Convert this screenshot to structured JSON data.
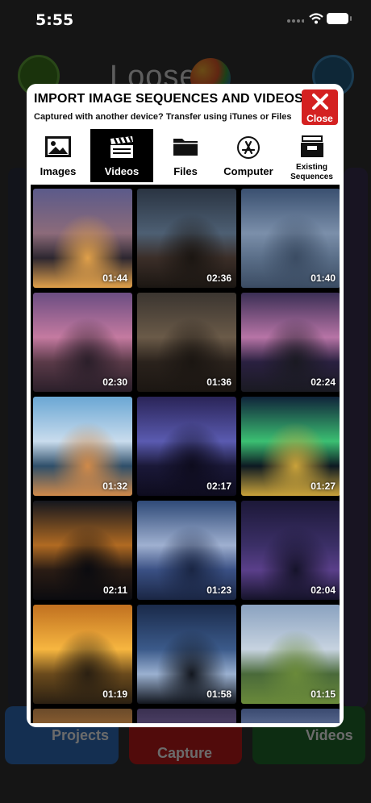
{
  "status": {
    "time": "5:55"
  },
  "background": {
    "logo_text": "Loose   it",
    "projects_label": "Projects",
    "capture_label": "Capture",
    "videos_label": "Videos"
  },
  "modal": {
    "title": "IMPORT IMAGE SEQUENCES AND VIDEOS",
    "subtitle": "Captured with another device? Transfer using iTunes or Files",
    "close_label": "Close",
    "tabs": [
      {
        "label": "Images",
        "icon": "image-icon"
      },
      {
        "label": "Videos",
        "icon": "clapperboard-icon",
        "active": true
      },
      {
        "label": "Files",
        "icon": "folder-icon"
      },
      {
        "label": "Computer",
        "icon": "app-store-icon"
      },
      {
        "label": "Existing Sequences",
        "icon": "archive-drawer-icon"
      }
    ],
    "videos": [
      {
        "duration": "01:44",
        "scene": "city night skyline",
        "colors": [
          "#5b5a8a",
          "#8c6b7a",
          "#2d2730",
          "#e0a04a"
        ]
      },
      {
        "duration": "02:36",
        "scene": "cave with lightning",
        "colors": [
          "#2a3442",
          "#4d5f73",
          "#3b2e28",
          "#1b1612"
        ]
      },
      {
        "duration": "01:40",
        "scene": "harbor skyline dusk",
        "colors": [
          "#3a5070",
          "#7b8faa",
          "#5a6e88",
          "#3b4c63"
        ]
      },
      {
        "duration": "02:30",
        "scene": "twin towers sunset",
        "colors": [
          "#6b4d82",
          "#c47aa0",
          "#5a3a48",
          "#2b1f2a"
        ]
      },
      {
        "duration": "01:36",
        "scene": "lightning storm",
        "colors": [
          "#3b3530",
          "#6a5a48",
          "#2a221c",
          "#1b1612"
        ]
      },
      {
        "duration": "02:24",
        "scene": "dead trees lake dusk",
        "colors": [
          "#3b2f55",
          "#b774a6",
          "#2a2040",
          "#1a1a22"
        ]
      },
      {
        "duration": "01:32",
        "scene": "mosque waterfront",
        "colors": [
          "#6aa7d4",
          "#c9dced",
          "#2f4f6a",
          "#d08a4a"
        ]
      },
      {
        "duration": "02:17",
        "scene": "purple lightning",
        "colors": [
          "#2a2458",
          "#5a5bb0",
          "#1a1838",
          "#0e0c1e"
        ]
      },
      {
        "duration": "01:27",
        "scene": "aurora",
        "colors": [
          "#10243a",
          "#3bbf72",
          "#0d1a22",
          "#c9a23a"
        ]
      },
      {
        "duration": "02:11",
        "scene": "canal bridge night",
        "colors": [
          "#14161e",
          "#b06a22",
          "#2a1c14",
          "#0b0b0f"
        ]
      },
      {
        "duration": "01:23",
        "scene": "storm clouds",
        "colors": [
          "#2f4a78",
          "#9fb0d0",
          "#3a5084",
          "#1a2644"
        ]
      },
      {
        "duration": "02:04",
        "scene": "starry sky lightning",
        "colors": [
          "#1c1838",
          "#3b2f66",
          "#5a3f8a",
          "#15132a"
        ]
      },
      {
        "duration": "01:19",
        "scene": "mountain sunrise",
        "colors": [
          "#c07020",
          "#f7b640",
          "#6a4a1c",
          "#2b2012"
        ]
      },
      {
        "duration": "01:58",
        "scene": "highway light trails",
        "colors": [
          "#1a2a4a",
          "#3b5a8a",
          "#9ab0d0",
          "#12161e"
        ]
      },
      {
        "duration": "01:15",
        "scene": "green hills valley",
        "colors": [
          "#8aa2c0",
          "#c7d3e0",
          "#4a6a3a",
          "#6a8a3a"
        ]
      },
      {
        "duration": "",
        "scene": "partial row",
        "colors": [
          "#6a4a2a",
          "#c0803a",
          "#4a3020",
          "#2a1c14"
        ]
      },
      {
        "duration": "",
        "scene": "partial row",
        "colors": [
          "#3a3050",
          "#6a5a8a",
          "#2a2238",
          "#1a1622"
        ]
      },
      {
        "duration": "",
        "scene": "partial row",
        "colors": [
          "#3a4a70",
          "#8a9ac0",
          "#2a3858",
          "#1a2238"
        ]
      }
    ]
  }
}
